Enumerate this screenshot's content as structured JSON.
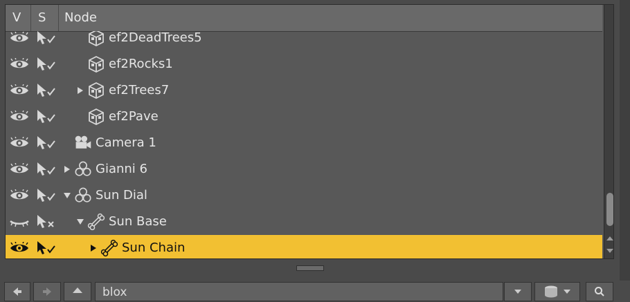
{
  "header": {
    "col_v": "V",
    "col_s": "S",
    "col_node": "Node"
  },
  "rows": [
    {
      "label": "ef2DeadTrees5",
      "visible": true,
      "selectable": true,
      "depth": 2,
      "icon": "prop-cube-icon",
      "expander": "none",
      "selected": false
    },
    {
      "label": "ef2Rocks1",
      "visible": true,
      "selectable": true,
      "depth": 2,
      "icon": "prop-cube-icon",
      "expander": "none",
      "selected": false
    },
    {
      "label": "ef2Trees7",
      "visible": true,
      "selectable": true,
      "depth": 2,
      "icon": "prop-cube-icon",
      "expander": "collapsed",
      "selected": false
    },
    {
      "label": "ef2Pave",
      "visible": true,
      "selectable": true,
      "depth": 2,
      "icon": "prop-cube-icon",
      "expander": "none",
      "selected": false
    },
    {
      "label": "Camera 1",
      "visible": true,
      "selectable": true,
      "depth": 1,
      "icon": "camera-icon",
      "expander": "none",
      "selected": false
    },
    {
      "label": "Gianni 6",
      "visible": true,
      "selectable": true,
      "depth": 1,
      "icon": "figure-icon",
      "expander": "collapsed",
      "selected": false
    },
    {
      "label": "Sun Dial",
      "visible": true,
      "selectable": true,
      "depth": 1,
      "icon": "figure-icon",
      "expander": "expanded",
      "selected": false
    },
    {
      "label": "Sun Base",
      "visible": false,
      "selectable": false,
      "depth": 2,
      "icon": "bone-icon",
      "expander": "expanded",
      "selected": false
    },
    {
      "label": "Sun Chain",
      "visible": true,
      "selectable": true,
      "depth": 3,
      "icon": "bone-icon",
      "expander": "collapsed",
      "selected": true
    }
  ],
  "bottom": {
    "search_value": "blox"
  },
  "colors": {
    "selection": "#f2c032",
    "panel": "#585858",
    "header": "#696969"
  }
}
